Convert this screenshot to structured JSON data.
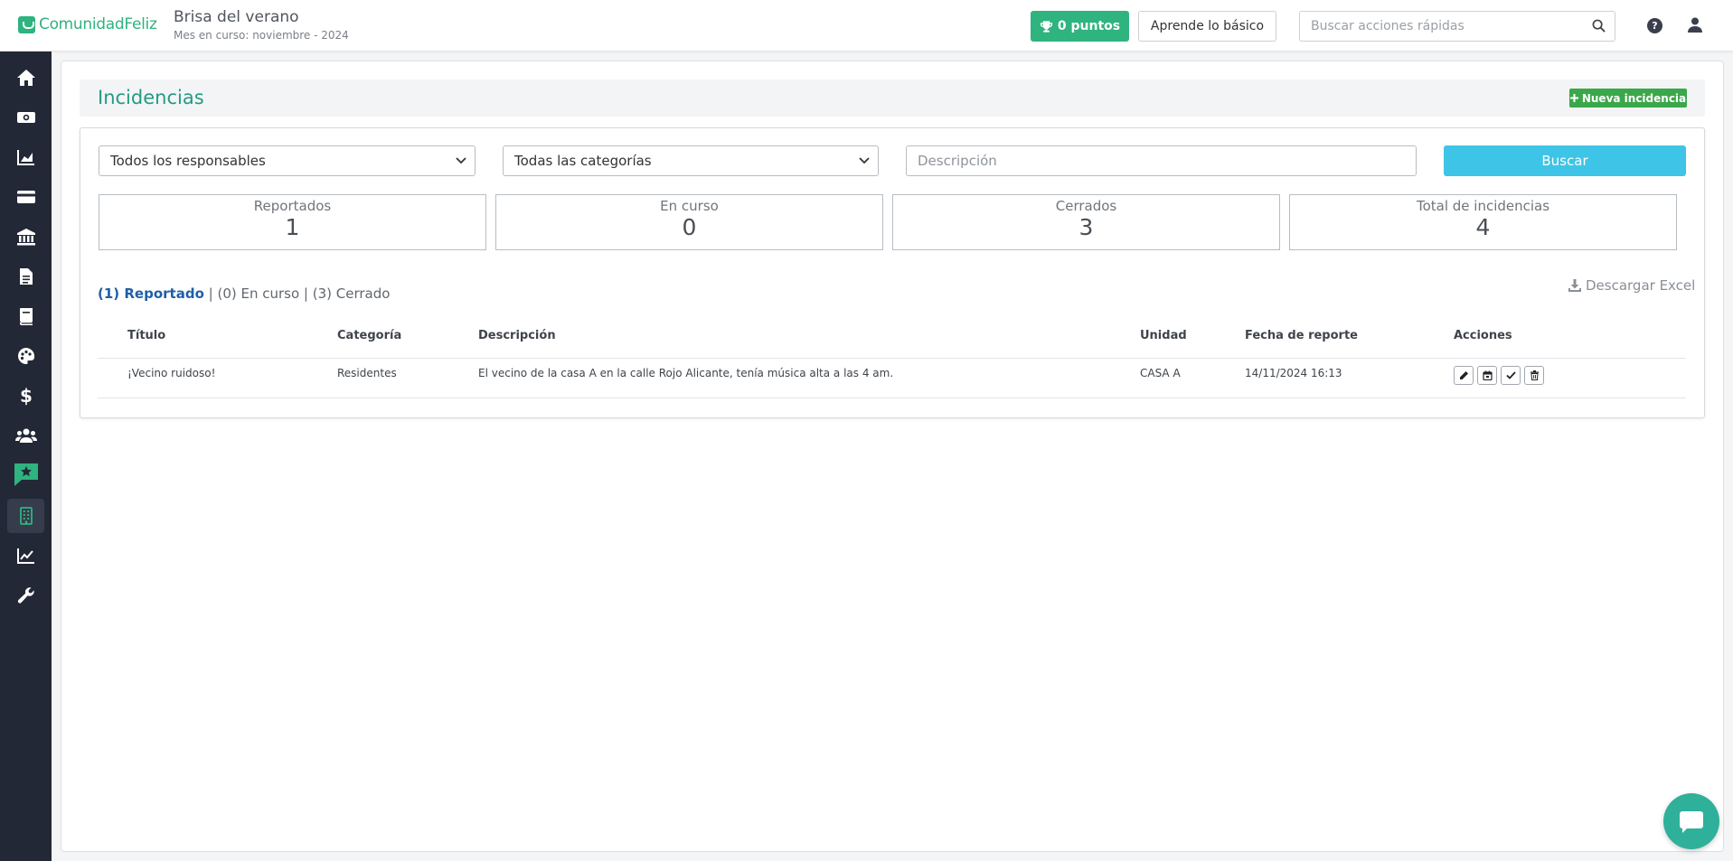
{
  "app": {
    "logo_text": "ComunidadFeliz",
    "community_name": "Brisa del verano",
    "current_month": "Mes en curso: noviembre - 2024"
  },
  "topbar": {
    "points_label": "0 puntos",
    "learn_label": "Aprende lo básico",
    "quick_search_placeholder": "Buscar acciones rápidas"
  },
  "sidebar": {
    "items": [
      {
        "icon": "home-icon"
      },
      {
        "icon": "money-icon"
      },
      {
        "icon": "area-chart-icon"
      },
      {
        "icon": "credit-card-icon"
      },
      {
        "icon": "bank-icon"
      },
      {
        "icon": "document-icon"
      },
      {
        "icon": "book-icon"
      },
      {
        "icon": "palette-icon"
      },
      {
        "icon": "dollar-icon"
      },
      {
        "icon": "users-icon"
      },
      {
        "icon": "chat-star-icon"
      },
      {
        "icon": "building-icon",
        "active": true
      },
      {
        "icon": "line-chart-icon"
      },
      {
        "icon": "wrench-icon"
      }
    ]
  },
  "page": {
    "title": "Incidencias",
    "new_button": "Nueva incidencia"
  },
  "filters": {
    "responsables_selected": "Todos los responsables",
    "categorias_selected": "Todas las categorías",
    "description_placeholder": "Descripción",
    "search_button": "Buscar"
  },
  "stats": [
    {
      "label": "Reportados",
      "value": "1"
    },
    {
      "label": "En curso",
      "value": "0"
    },
    {
      "label": "Cerrados",
      "value": "3"
    },
    {
      "label": "Total de incidencias",
      "value": "4"
    }
  ],
  "status_tabs": {
    "reported": "(1) Reportado",
    "sep1": " | ",
    "in_progress": "(0) En curso",
    "sep2": " | ",
    "closed": "(3) Cerrado"
  },
  "download_label": "Descargar Excel",
  "table": {
    "headers": {
      "title": "Título",
      "category": "Categoría",
      "description": "Descripción",
      "unit": "Unidad",
      "report_date": "Fecha de reporte",
      "actions": "Acciones"
    },
    "rows": [
      {
        "title": "¡Vecino ruidoso!",
        "category": "Residentes",
        "description": "El vecino de la casa A en la calle Rojo Alicante, tenía música alta a las 4 am.",
        "unit": "CASA A",
        "report_date": "14/11/2024 16:13"
      }
    ]
  }
}
